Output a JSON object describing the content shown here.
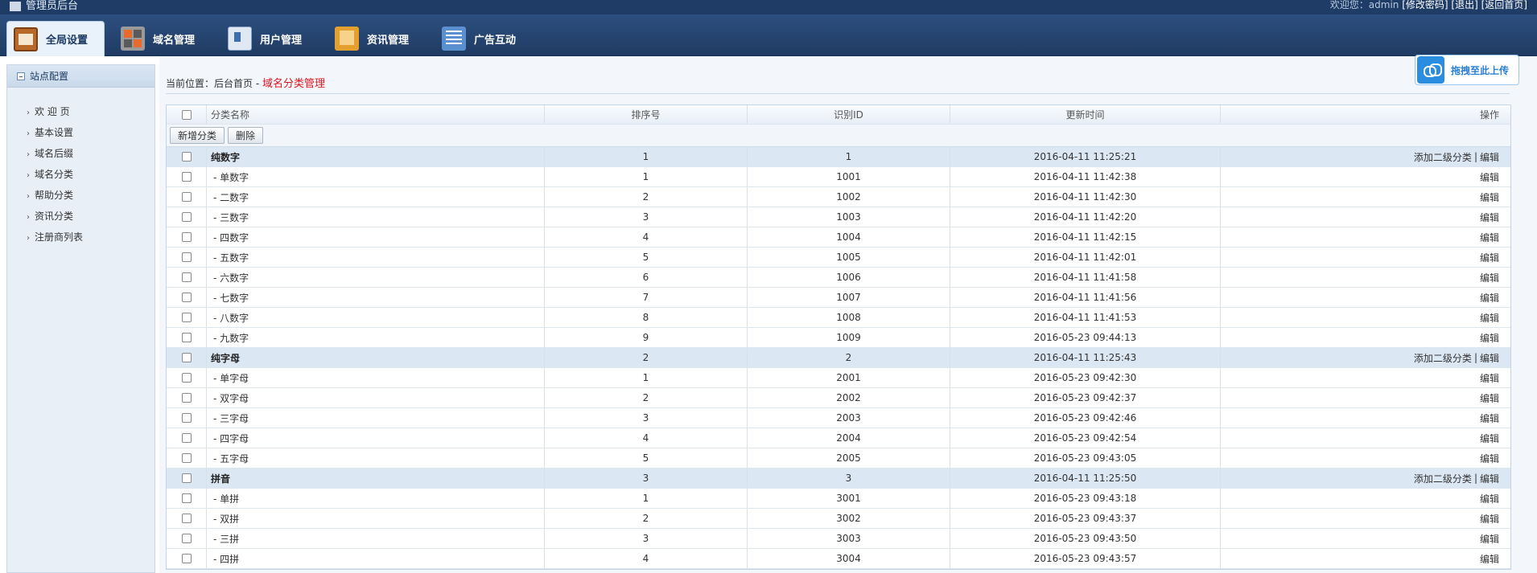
{
  "top": {
    "system_title": "管理员后台",
    "welcome_text": "欢迎您：admin",
    "change_password": "[修改密码]",
    "logout": "[退出]",
    "back_home": "[返回首页]"
  },
  "nav": {
    "tabs": [
      {
        "label": "全局设置",
        "icon": "settings-box-icon",
        "active": true
      },
      {
        "label": "域名管理",
        "icon": "grid-tiles-icon"
      },
      {
        "label": "用户管理",
        "icon": "user-card-icon"
      },
      {
        "label": "资讯管理",
        "icon": "folder-icon"
      },
      {
        "label": "广告互动",
        "icon": "list-document-icon"
      }
    ]
  },
  "sidebar": {
    "header": "站点配置",
    "items": [
      {
        "label": "欢 迎 页"
      },
      {
        "label": "基本设置"
      },
      {
        "label": "域名后缀"
      },
      {
        "label": "域名分类"
      },
      {
        "label": "帮助分类"
      },
      {
        "label": "资讯分类"
      },
      {
        "label": "注册商列表"
      }
    ]
  },
  "breadcrumb": {
    "prefix": "当前位置：",
    "home": "后台首页",
    "sep": " - ",
    "current": "域名分类管理"
  },
  "upload": {
    "label": "拖拽至此上传",
    "icon": "cloud-upload-icon"
  },
  "table": {
    "headers": {
      "name": "分类名称",
      "sort": "排序号",
      "id": "识别ID",
      "time": "更新时间",
      "ops": "操作"
    },
    "toolbar": {
      "add": "新增分类",
      "delete": "删除"
    },
    "op_add_sub": "添加二级分类",
    "op_sep": "|",
    "op_edit": "编辑",
    "rows": [
      {
        "level": "parent",
        "name": "纯数字",
        "sort": "1",
        "id": "1",
        "time": "2016-04-11 11:25:21"
      },
      {
        "level": "child",
        "name": "- 单数字",
        "sort": "1",
        "id": "1001",
        "time": "2016-04-11 11:42:38"
      },
      {
        "level": "child",
        "name": "- 二数字",
        "sort": "2",
        "id": "1002",
        "time": "2016-04-11 11:42:30"
      },
      {
        "level": "child",
        "name": "- 三数字",
        "sort": "3",
        "id": "1003",
        "time": "2016-04-11 11:42:20"
      },
      {
        "level": "child",
        "name": "- 四数字",
        "sort": "4",
        "id": "1004",
        "time": "2016-04-11 11:42:15"
      },
      {
        "level": "child",
        "name": "- 五数字",
        "sort": "5",
        "id": "1005",
        "time": "2016-04-11 11:42:01"
      },
      {
        "level": "child",
        "name": "- 六数字",
        "sort": "6",
        "id": "1006",
        "time": "2016-04-11 11:41:58"
      },
      {
        "level": "child",
        "name": "- 七数字",
        "sort": "7",
        "id": "1007",
        "time": "2016-04-11 11:41:56"
      },
      {
        "level": "child",
        "name": "- 八数字",
        "sort": "8",
        "id": "1008",
        "time": "2016-04-11 11:41:53"
      },
      {
        "level": "child",
        "name": "- 九数字",
        "sort": "9",
        "id": "1009",
        "time": "2016-05-23 09:44:13"
      },
      {
        "level": "parent",
        "name": "纯字母",
        "sort": "2",
        "id": "2",
        "time": "2016-04-11 11:25:43"
      },
      {
        "level": "child",
        "name": "- 单字母",
        "sort": "1",
        "id": "2001",
        "time": "2016-05-23 09:42:30"
      },
      {
        "level": "child",
        "name": "- 双字母",
        "sort": "2",
        "id": "2002",
        "time": "2016-05-23 09:42:37"
      },
      {
        "level": "child",
        "name": "- 三字母",
        "sort": "3",
        "id": "2003",
        "time": "2016-05-23 09:42:46"
      },
      {
        "level": "child",
        "name": "- 四字母",
        "sort": "4",
        "id": "2004",
        "time": "2016-05-23 09:42:54"
      },
      {
        "level": "child",
        "name": "- 五字母",
        "sort": "5",
        "id": "2005",
        "time": "2016-05-23 09:43:05"
      },
      {
        "level": "parent",
        "name": "拼音",
        "sort": "3",
        "id": "3",
        "time": "2016-04-11 11:25:50"
      },
      {
        "level": "child",
        "name": "- 单拼",
        "sort": "1",
        "id": "3001",
        "time": "2016-05-23 09:43:18"
      },
      {
        "level": "child",
        "name": "- 双拼",
        "sort": "2",
        "id": "3002",
        "time": "2016-05-23 09:43:37"
      },
      {
        "level": "child",
        "name": "- 三拼",
        "sort": "3",
        "id": "3003",
        "time": "2016-05-23 09:43:50"
      },
      {
        "level": "child",
        "name": "- 四拼",
        "sort": "4",
        "id": "3004",
        "time": "2016-05-23 09:43:57"
      }
    ]
  }
}
